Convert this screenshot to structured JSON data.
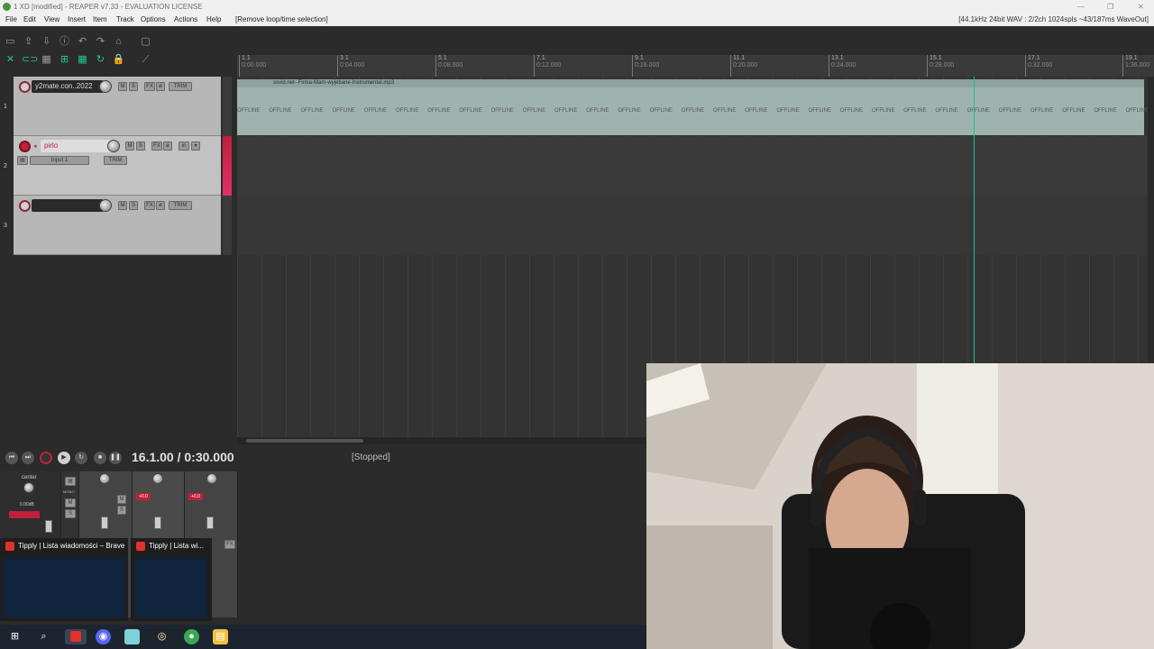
{
  "window": {
    "title": "1 XD [modified] - REAPER v7.33 - EVALUATION LICENSE"
  },
  "menu": {
    "items": [
      "File",
      "Edit",
      "View",
      "Insert",
      "Item",
      "Track",
      "Options",
      "Actions",
      "Help"
    ],
    "action_hint": "[Remove loop/time selection]",
    "audio_status": "[44.1kHz 24bit WAV : 2/2ch 1024spls ~43/187ms WaveOut]"
  },
  "ruler": {
    "marks": [
      {
        "bar": "1.1",
        "time": "0:00.000"
      },
      {
        "bar": "3.1",
        "time": "0:04.000"
      },
      {
        "bar": "5.1",
        "time": "0:08.000"
      },
      {
        "bar": "7.1",
        "time": "0:12.000"
      },
      {
        "bar": "9.1",
        "time": "0:16.000"
      },
      {
        "bar": "11.1",
        "time": "0:20.000"
      },
      {
        "bar": "13.1",
        "time": "0:24.000"
      },
      {
        "bar": "15.1",
        "time": "0:28.000"
      },
      {
        "bar": "17.1",
        "time": "0:32.000"
      },
      {
        "bar": "19.1",
        "time": "1:36.000"
      }
    ]
  },
  "tracks": [
    {
      "number": "1",
      "name": "y2mate.con..2022",
      "armed": false
    },
    {
      "number": "2",
      "name": "pirlo",
      "armed": true,
      "input": "Input 1",
      "input_mode": "in"
    },
    {
      "number": "3",
      "name": "",
      "armed": false
    }
  ],
  "track_buttons": {
    "mute": "M",
    "solo": "S",
    "fx": "FX",
    "phase": "ø",
    "trim": "TRIM"
  },
  "media_item": {
    "title": "ssvid.net--Firma-Mam-wyjebane-Instrumental.mp3",
    "offline_label": "OFFLINE"
  },
  "transport": {
    "position": "16.1.00 / 0:30.000",
    "state": "[Stopped]"
  },
  "mixer": {
    "master_pan": "center",
    "master_volume": "0.00dB",
    "mono_label": "MONO",
    "peak_labels": [
      "+0.0",
      "+0.0"
    ],
    "fx_label": "FX"
  },
  "task_previews": [
    {
      "title": "Tipply | Lista wiadomości – Brave"
    },
    {
      "title": "Tipply | Lista wi..."
    }
  ],
  "taskbar": {
    "icons": [
      "windows-start",
      "search",
      "brave",
      "discord",
      "app-teal",
      "app-obs",
      "chrome",
      "file-explorer"
    ]
  },
  "colors": {
    "accent_green": "#19c29a",
    "record_red": "#c0203a",
    "item_color": "#9fb3ae"
  }
}
